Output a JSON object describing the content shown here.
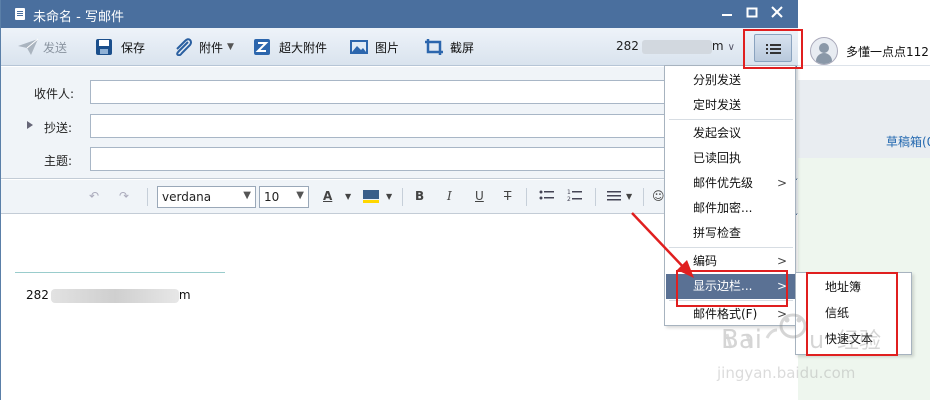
{
  "window": {
    "title": "未命名 - 写邮件",
    "controls": [
      "minimize",
      "maximize",
      "close"
    ]
  },
  "toolbar": {
    "send_label": "发送",
    "save_label": "保存",
    "attach_label": "附件",
    "big_attach_label": "超大附件",
    "image_label": "图片",
    "screenshot_label": "截屏",
    "sender_prefix": "282",
    "sender_suffix": "m"
  },
  "fields": {
    "to_label": "收件人:",
    "cc_label": "抄送:",
    "subject_label": "主题:",
    "to_value": "",
    "cc_value": "",
    "subject_value": ""
  },
  "format": {
    "font": "verdana",
    "size": "10"
  },
  "editor": {
    "body_prefix": "282",
    "body_suffix": "m"
  },
  "account": {
    "name": "多懂一点点112",
    "drafts_label": "草稿箱(0"
  },
  "menu": {
    "items": [
      {
        "label": "分别发送",
        "submenu": false
      },
      {
        "label": "定时发送",
        "submenu": false
      },
      {
        "label": "发起会议",
        "submenu": false
      },
      {
        "label": "已读回执",
        "submenu": false
      },
      {
        "label": "邮件优先级",
        "submenu": true
      },
      {
        "label": "邮件加密...",
        "submenu": false
      },
      {
        "label": "拼写检查",
        "submenu": false
      },
      {
        "label": "编码",
        "submenu": true
      },
      {
        "label": "显示边栏...",
        "submenu": true,
        "active": true
      },
      {
        "label": "邮件格式(F)",
        "submenu": true
      }
    ]
  },
  "submenu": {
    "items": [
      "地址簿",
      "信纸",
      "快速文本"
    ]
  },
  "watermark": {
    "brand": "Baidu",
    "text": "经验",
    "url": "jingyan.baidu.com"
  },
  "colors": {
    "titlebar": "#4a6f9e",
    "menu_active": "#5a7194",
    "highlight_box": "#e01f1f",
    "annotation_arrow": "#e01f1f"
  }
}
